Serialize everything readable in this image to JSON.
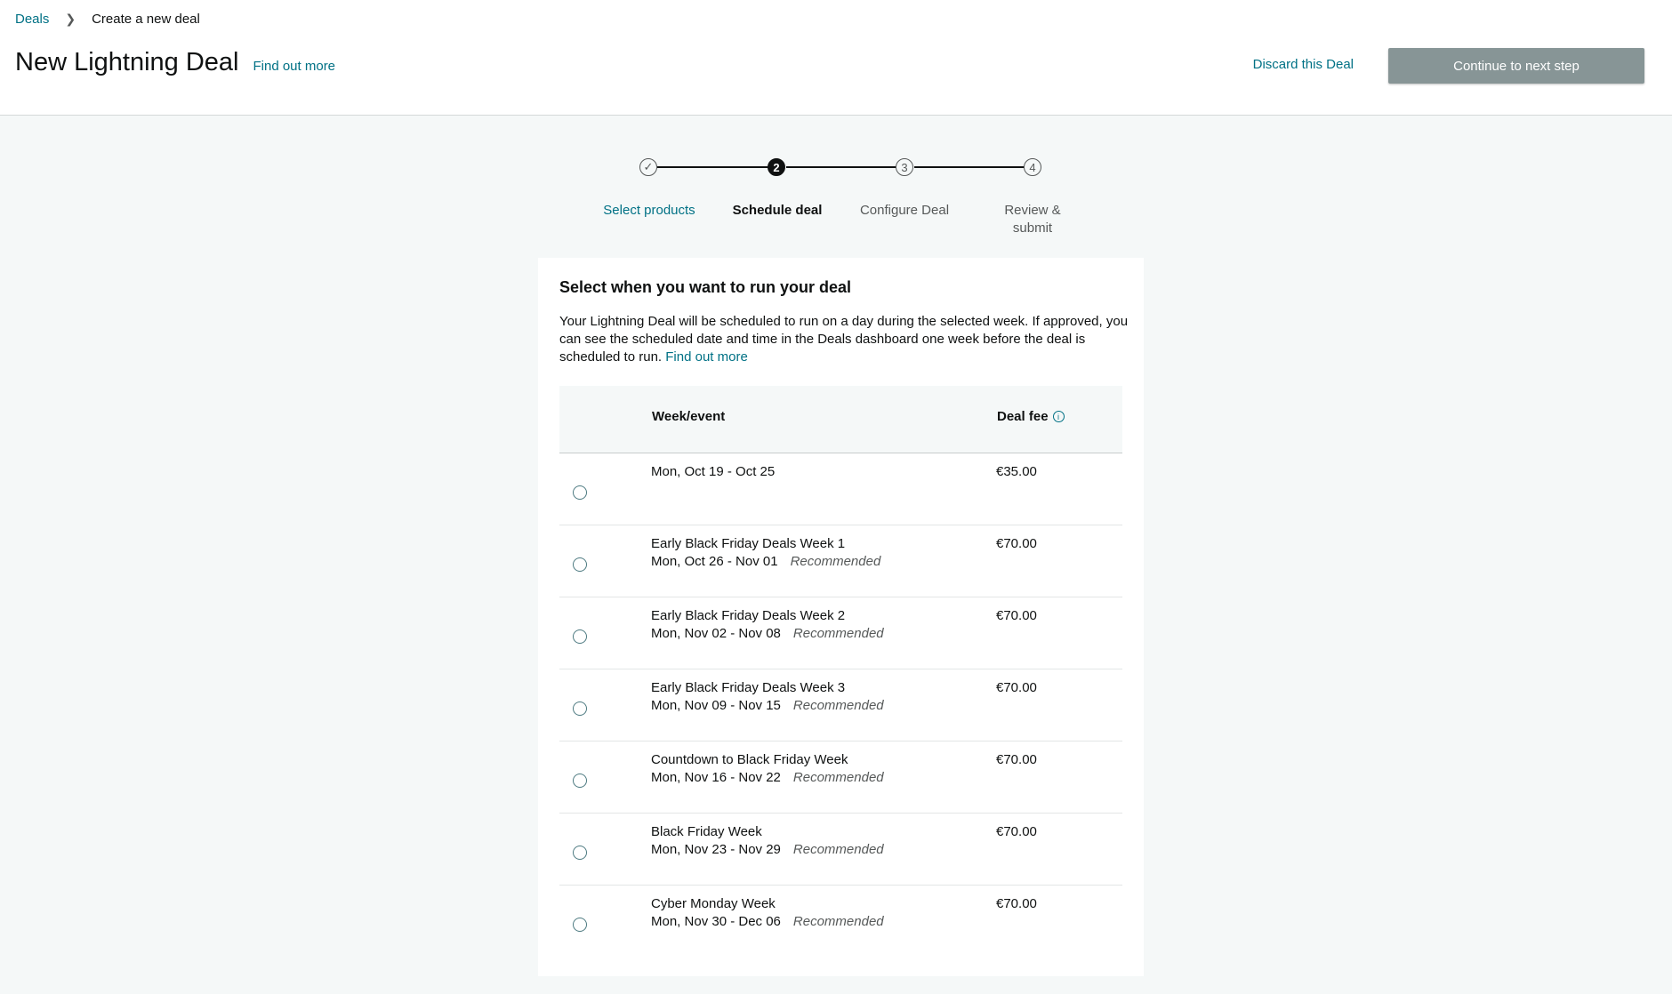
{
  "breadcrumb": {
    "root": "Deals",
    "current": "Create a new deal"
  },
  "header": {
    "title": "New Lightning Deal",
    "find_out_more": "Find out more",
    "discard": "Discard this Deal",
    "continue": "Continue to next step"
  },
  "stepper": {
    "steps": [
      {
        "marker": "✓",
        "label": "Select products",
        "state": "complete"
      },
      {
        "marker": "2",
        "label": "Schedule deal",
        "state": "active"
      },
      {
        "marker": "3",
        "label": "Configure Deal",
        "state": "upcoming"
      },
      {
        "marker": "4",
        "label": "Review & submit",
        "state": "upcoming"
      }
    ]
  },
  "card": {
    "heading": "Select when you want to run your deal",
    "description": "Your Lightning Deal will be scheduled to run on a day during the selected week. If approved, you can see the scheduled date and time in the Deals dashboard one week before the deal is scheduled to run.",
    "find_out_more": "Find out more"
  },
  "table": {
    "columns": {
      "week": "Week/event",
      "fee": "Deal fee"
    },
    "rows": [
      {
        "event": "",
        "dates": "Mon, Oct 19 - Oct 25",
        "tag": "",
        "fee": "€35.00"
      },
      {
        "event": "Early Black Friday Deals Week 1",
        "dates": "Mon, Oct 26 - Nov 01",
        "tag": "Recommended",
        "fee": "€70.00"
      },
      {
        "event": "Early Black Friday Deals Week 2",
        "dates": "Mon, Nov 02 - Nov 08",
        "tag": "Recommended",
        "fee": "€70.00"
      },
      {
        "event": "Early Black Friday Deals Week 3",
        "dates": "Mon, Nov 09 - Nov 15",
        "tag": "Recommended",
        "fee": "€70.00"
      },
      {
        "event": "Countdown to Black Friday Week",
        "dates": "Mon, Nov 16 - Nov 22",
        "tag": "Recommended",
        "fee": "€70.00"
      },
      {
        "event": "Black Friday Week",
        "dates": "Mon, Nov 23 - Nov 29",
        "tag": "Recommended",
        "fee": "€70.00"
      },
      {
        "event": "Cyber Monday Week",
        "dates": "Mon, Nov 30 - Dec 06",
        "tag": "Recommended",
        "fee": "€70.00"
      }
    ]
  }
}
